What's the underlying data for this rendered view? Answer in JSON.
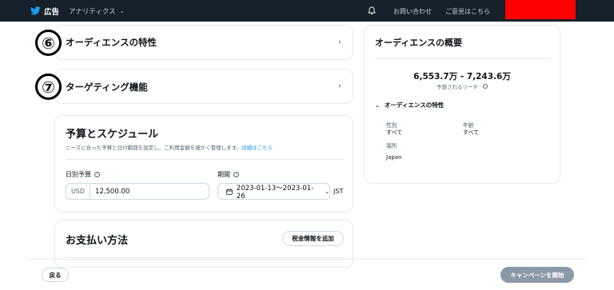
{
  "topbar": {
    "brand_label": "広告",
    "analytics_menu": "アナリティクス",
    "contact": "お問い合わせ",
    "feedback": "ご意見はこちら"
  },
  "steps": [
    {
      "number": "⑥",
      "title": "オーディエンスの特性"
    },
    {
      "number": "⑦",
      "title": "ターゲティング機能"
    }
  ],
  "budget": {
    "title": "予算とスケジュール",
    "description": "ニーズに合った予算と日付範囲を設定し、ご利用金額を細かく管理します。",
    "learn_more": "詳細はこちら",
    "daily_label": "日別予算",
    "currency": "USD",
    "amount": "12,500.00",
    "period_label": "期間",
    "period_value": "2023-01-13〜2023-01-26",
    "timezone": "JST"
  },
  "payment": {
    "title": "お支払い方法",
    "tax_button": "税金情報を追加"
  },
  "overview": {
    "title": "オーディエンスの概要",
    "reach": "6,553.7万 - 7,243.6万",
    "reach_caption": "予想されるリーチ",
    "section_label": "オーディエンスの特性",
    "gender_label": "性別",
    "gender_value": "すべて",
    "age_label": "年齢",
    "age_value": "すべて",
    "location_label": "場所",
    "location_value": "Japan"
  },
  "footer": {
    "back": "戻る",
    "launch": "キャンペーンを開始"
  },
  "colors": {
    "topbar_bg": "#15202b",
    "link": "#1d9bf0",
    "launch_disabled": "#8b98a5",
    "redaction": "#ff0000"
  }
}
